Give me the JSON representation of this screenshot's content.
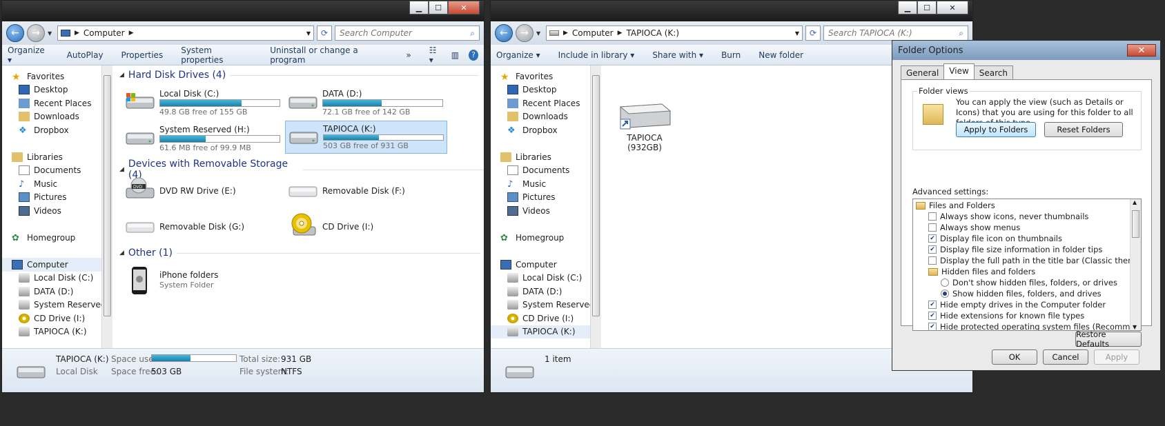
{
  "win1": {
    "address": "Computer",
    "search_placeholder": "Search Computer",
    "toolbar": [
      "Organize",
      "AutoPlay",
      "Properties",
      "System properties",
      "Uninstall or change a program",
      "»"
    ],
    "nav": [
      "Favorites",
      "Desktop",
      "Recent Places",
      "Downloads",
      "Dropbox",
      "Libraries",
      "Documents",
      "Music",
      "Pictures",
      "Videos",
      "Homegroup",
      "Computer",
      "Local Disk (C:)",
      "DATA (D:)",
      "System Reserved (H",
      "CD Drive (I:)",
      "TAPIOCA (K:)"
    ],
    "groups": {
      "hdd": "Hard Disk Drives (4)",
      "removable": "Devices with Removable Storage (4)",
      "other": "Other (1)"
    },
    "drives": [
      {
        "name": "Local Disk (C:)",
        "free": "49.8 GB free of 155 GB",
        "used_fraction": 0.68
      },
      {
        "name": "DATA (D:)",
        "free": "72.1 GB free of 142 GB",
        "used_fraction": 0.49
      },
      {
        "name": "System Reserved (H:)",
        "free": "61.6 MB free of 99.9 MB",
        "used_fraction": 0.38
      },
      {
        "name": "TAPIOCA (K:)",
        "free": "503 GB free of 931 GB",
        "used_fraction": 0.46
      }
    ],
    "removable": [
      "DVD RW Drive (E:)",
      "Removable Disk (F:)",
      "Removable Disk (G:)",
      "CD Drive (I:)"
    ],
    "other": {
      "name": "iPhone folders",
      "sub": "System Folder"
    },
    "details": {
      "name": "TAPIOCA (K:)",
      "type": "Local Disk",
      "space_used_label": "Space used:",
      "space_free_label": "Space free:",
      "space_free": "503 GB",
      "total_size_label": "Total size:",
      "total_size": "931 GB",
      "fs_label": "File system:",
      "fs": "NTFS",
      "used_fraction": 0.46
    }
  },
  "win2": {
    "address_1": "Computer",
    "address_2": "TAPIOCA (K:)",
    "search_placeholder": "Search TAPIOCA (K:)",
    "toolbar": [
      "Organize",
      "Include in library",
      "Share with",
      "Burn",
      "New folder"
    ],
    "item_name": "TAPIOCA",
    "item_size": "(932GB)",
    "status": "1 item"
  },
  "dialog": {
    "title": "Folder Options",
    "tabs": [
      "General",
      "View",
      "Search"
    ],
    "folder_views_label": "Folder views",
    "folder_views_text": "You can apply the view (such as Details or Icons) that you are using for this folder to all folders of this type.",
    "apply_btn": "Apply to Folders",
    "reset_btn": "Reset Folders",
    "advanced_label": "Advanced settings:",
    "settings": [
      {
        "kind": "folder",
        "label": "Files and Folders",
        "indent": 0
      },
      {
        "kind": "check",
        "label": "Always show icons, never thumbnails",
        "checked": false,
        "indent": 1
      },
      {
        "kind": "check",
        "label": "Always show menus",
        "checked": false,
        "indent": 1
      },
      {
        "kind": "check",
        "label": "Display file icon on thumbnails",
        "checked": true,
        "indent": 1
      },
      {
        "kind": "check",
        "label": "Display file size information in folder tips",
        "checked": true,
        "indent": 1
      },
      {
        "kind": "check",
        "label": "Display the full path in the title bar (Classic theme only)",
        "checked": false,
        "indent": 1
      },
      {
        "kind": "folder",
        "label": "Hidden files and folders",
        "indent": 1
      },
      {
        "kind": "radio",
        "label": "Don't show hidden files, folders, or drives",
        "checked": false,
        "indent": 2
      },
      {
        "kind": "radio",
        "label": "Show hidden files, folders, and drives",
        "checked": true,
        "indent": 2
      },
      {
        "kind": "check",
        "label": "Hide empty drives in the Computer folder",
        "checked": true,
        "indent": 1
      },
      {
        "kind": "check",
        "label": "Hide extensions for known file types",
        "checked": true,
        "indent": 1
      },
      {
        "kind": "check",
        "label": "Hide protected operating system files (Recommended)",
        "checked": true,
        "indent": 1
      }
    ],
    "restore_btn": "Restore Defaults",
    "ok_btn": "OK",
    "cancel_btn": "Cancel",
    "apply_disabled_btn": "Apply"
  },
  "colors": {
    "accent": "#1e3287",
    "bar": "#26a0d0"
  }
}
